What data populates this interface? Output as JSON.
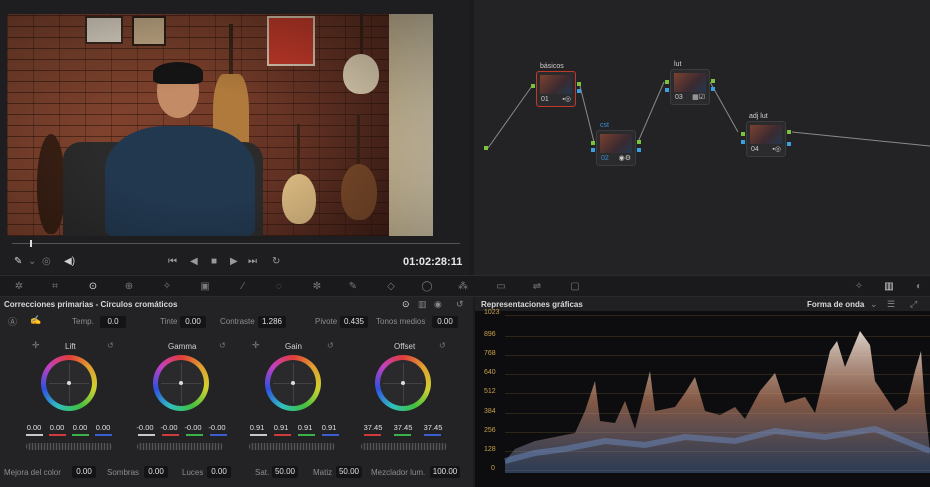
{
  "viewer": {
    "timecode": "01:02:28:11",
    "icons": [
      "picker-icon",
      "audio-icon",
      "volume-icon",
      "skip-start-icon",
      "step-back-icon",
      "stop-icon",
      "play-icon",
      "skip-end-icon",
      "loop-icon"
    ]
  },
  "node_editor": {
    "nodes": [
      {
        "label": "básicos",
        "num": "01",
        "label_color": "#d0d0d0",
        "selected": true
      },
      {
        "label": "cst",
        "num": "02",
        "label_color": "#3a8fd6",
        "selected": false
      },
      {
        "label": "lut",
        "num": "03",
        "label_color": "#d0d0d0",
        "selected": false
      },
      {
        "label": "adj lut",
        "num": "04",
        "label_color": "#d0d0d0",
        "selected": false
      }
    ]
  },
  "primaries": {
    "title": "Correcciones primarias - Círculos cromáticos",
    "params": {
      "temp_label": "Temp.",
      "temp": "0.0",
      "tint_label": "Tinte",
      "tint": "0.00",
      "contrast_label": "Contraste",
      "contrast": "1.286",
      "pivot_label": "Pivote",
      "pivot": "0.435",
      "midtones_label": "Tonos medios",
      "midtones": "0.00"
    },
    "wheels": [
      {
        "name": "Lift",
        "values": [
          "0.00",
          "0.00",
          "0.00",
          "0.00"
        ]
      },
      {
        "name": "Gamma",
        "values": [
          "-0.00",
          "-0.00",
          "-0.00",
          "-0.00"
        ]
      },
      {
        "name": "Gain",
        "values": [
          "0.91",
          "0.91",
          "0.91",
          "0.91"
        ]
      },
      {
        "name": "Offset",
        "values": [
          "37.45",
          "37.45",
          "37.45"
        ]
      }
    ],
    "bottom": {
      "color_boost_label": "Mejora del color",
      "color_boost": "0.00",
      "shadows_label": "Sombras",
      "shadows": "0.00",
      "highlights_label": "Luces",
      "highlights": "0.00",
      "sat_label": "Sat.",
      "sat": "50.00",
      "hue_label": "Matiz",
      "hue": "50.00",
      "lum_mix_label": "Mezclador lum.",
      "lum_mix": "100.00"
    }
  },
  "scopes": {
    "title": "Representaciones gráficas",
    "mode": "Forma de onda",
    "y_ticks": [
      "1023",
      "896",
      "768",
      "640",
      "512",
      "384",
      "256",
      "128",
      "0"
    ]
  },
  "colors": {
    "accent_red": "#c0392b",
    "node_link": "#8a8a8a",
    "node_out_green": "#79c33d",
    "node_out_blue": "#3aa0e0",
    "scope_label": "#c7a04a"
  }
}
